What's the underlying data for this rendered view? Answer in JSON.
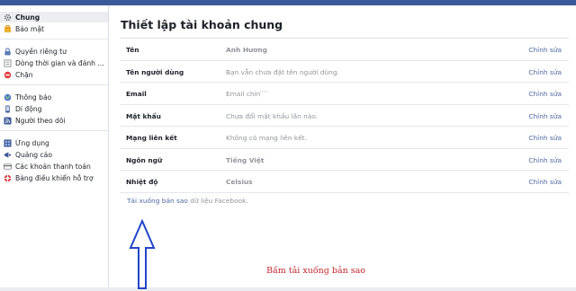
{
  "sidebar": {
    "groups": [
      [
        {
          "label": "Chung",
          "icon": "gear-icon",
          "active": true
        },
        {
          "label": "Bảo mật",
          "icon": "shield-icon"
        }
      ],
      [
        {
          "label": "Quyền riêng tư",
          "icon": "lock-icon"
        },
        {
          "label": "Dòng thời gian và đánh ...",
          "icon": "timeline-icon"
        },
        {
          "label": "Chặn",
          "icon": "block-icon"
        }
      ],
      [
        {
          "label": "Thông báo",
          "icon": "globe-icon"
        },
        {
          "label": "Di động",
          "icon": "mobile-icon"
        },
        {
          "label": "Người theo dõi",
          "icon": "rss-icon"
        }
      ],
      [
        {
          "label": "Ứng dụng",
          "icon": "apps-icon"
        },
        {
          "label": "Quảng cáo",
          "icon": "ads-icon"
        },
        {
          "label": "Các khoản thanh toán",
          "icon": "card-icon"
        },
        {
          "label": "Bảng điều khiển hỗ trợ",
          "icon": "lifebuoy-icon"
        }
      ]
    ]
  },
  "main": {
    "title": "Thiết lập tài khoản chung",
    "rows": [
      {
        "name": "Tên",
        "value": "Anh Hương",
        "bold": true,
        "edit": "Chỉnh sửa"
      },
      {
        "name": "Tên người dùng",
        "value": "Bạn vẫn chưa đặt tên người dùng.",
        "bold": false,
        "edit": "Chỉnh sửa"
      },
      {
        "name": "Email",
        "value": "Email chín ̀ ̀ ̀ ̀",
        "bold": false,
        "edit": "Chỉnh sửa"
      },
      {
        "name": "Mật khẩu",
        "value": "Chưa đổi mật khẩu lần nào.",
        "bold": false,
        "edit": "Chỉnh sửa"
      },
      {
        "name": "Mạng liên kết",
        "value": "Không có mạng liên kết.",
        "bold": false,
        "edit": "Chỉnh sửa"
      },
      {
        "name": "Ngôn ngữ",
        "value": "Tiếng Việt",
        "bold": true,
        "edit": "Chỉnh sửa"
      },
      {
        "name": "Nhiệt độ",
        "value": "Celsius",
        "bold": true,
        "edit": "Chỉnh sửa"
      }
    ],
    "download_link": "Tải xuống bản sao",
    "download_suffix": " dữ liệu Facebook."
  },
  "annotation": {
    "text": "Bấm tải xuống bản sao",
    "color": "#c0262d"
  },
  "colors": {
    "brand": "#3b5998",
    "link": "#4b67a1"
  }
}
